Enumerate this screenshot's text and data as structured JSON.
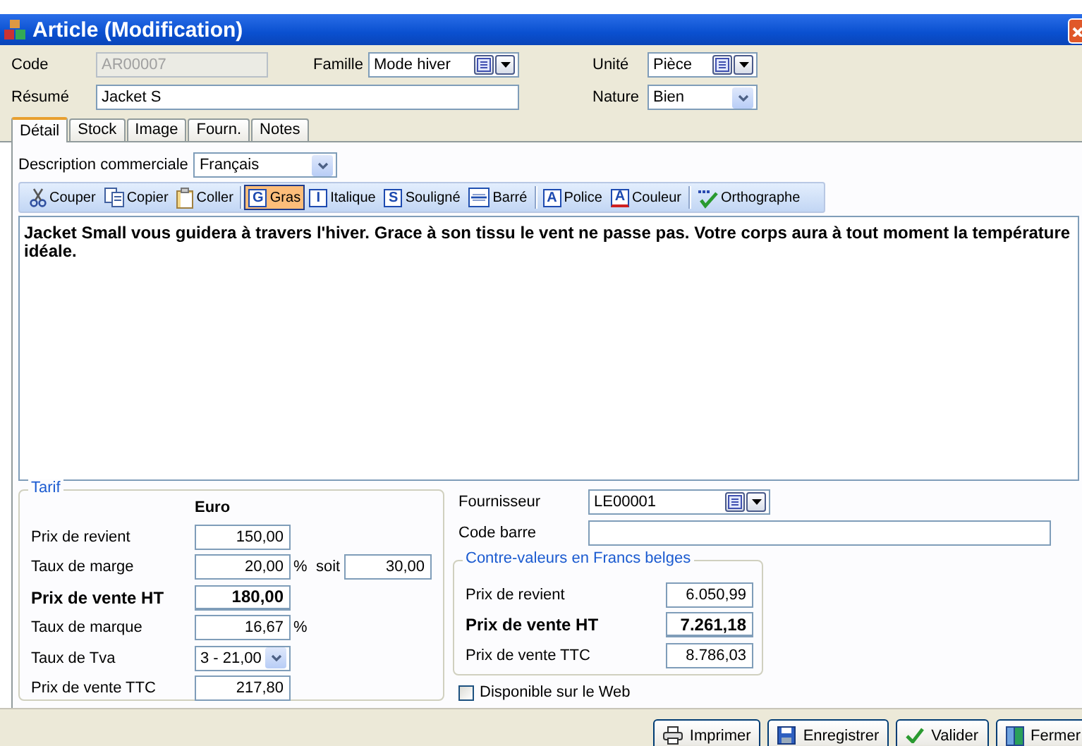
{
  "window": {
    "title": "Article (Modification)"
  },
  "header": {
    "code": {
      "label": "Code",
      "value": "AR00007",
      "disabled": true
    },
    "famille": {
      "label": "Famille",
      "value": "Mode hiver"
    },
    "unite": {
      "label": "Unité",
      "value": "Pièce"
    },
    "resume": {
      "label": "Résumé",
      "value": "Jacket S",
      "disabled": false
    },
    "nature": {
      "label": "Nature",
      "value": "Bien"
    }
  },
  "tabs": [
    {
      "label": "Détail",
      "selected": true
    },
    {
      "label": "Stock",
      "selected": false
    },
    {
      "label": "Image",
      "selected": false
    },
    {
      "label": "Fourn.",
      "selected": false
    },
    {
      "label": "Notes",
      "selected": false
    }
  ],
  "description": {
    "label": "Description commerciale",
    "value": "Français"
  },
  "toolbar": [
    {
      "kind": "cut",
      "label": "Couper",
      "selected": false,
      "separator_before": false
    },
    {
      "kind": "copy",
      "label": "Copier",
      "selected": false,
      "separator_before": false
    },
    {
      "kind": "paste",
      "label": "Coller",
      "selected": false,
      "separator_before": false
    },
    {
      "kind": "glyph",
      "glyph": "G",
      "label": "Gras",
      "selected": true,
      "separator_before": true
    },
    {
      "kind": "glyph",
      "glyph": "I",
      "label": "Italique",
      "selected": false,
      "separator_before": false
    },
    {
      "kind": "glyph",
      "glyph": "S",
      "label": "Souligné",
      "selected": false,
      "separator_before": false
    },
    {
      "kind": "strike",
      "label": "Barré",
      "selected": false,
      "separator_before": false
    },
    {
      "kind": "glyph",
      "glyph": "A",
      "label": "Police",
      "selected": false,
      "separator_before": true
    },
    {
      "kind": "color",
      "glyph": "A",
      "label": "Couleur",
      "selected": false,
      "separator_before": false
    },
    {
      "kind": "spell",
      "label": "Orthographe",
      "selected": false,
      "separator_before": true
    }
  ],
  "editor": {
    "text": "Jacket Small vous guidera à travers l'hiver. Grace à son tissu le vent ne passe pas. Votre corps aura à tout moment la température idéale."
  },
  "tarif": {
    "title": "Tarif",
    "currency": "Euro",
    "rows": [
      {
        "kind": "field",
        "label": "Prix de revient",
        "value": "150,00",
        "bold": false
      },
      {
        "kind": "percent_soit",
        "label": "Taux de marge",
        "value": "20,00",
        "suffix": "%",
        "extra_label": "soit",
        "extra_value": "30,00",
        "bold": false
      },
      {
        "kind": "field",
        "label": "Prix de vente HT",
        "value": "180,00",
        "bold": true
      },
      {
        "kind": "percent",
        "label": "Taux de marque",
        "value": "16,67",
        "suffix": "%",
        "bold": false
      },
      {
        "kind": "combo",
        "label": "Taux de Tva",
        "value": "3 - 21,00",
        "bold": false
      },
      {
        "kind": "field",
        "label": "Prix de vente TTC",
        "value": "217,80",
        "bold": false
      }
    ]
  },
  "fournisseur": {
    "label": "Fournisseur",
    "value": "LE00001"
  },
  "code_barre": {
    "label": "Code barre"
  },
  "contre_valeurs": {
    "title": "Contre-valeurs en Francs belges",
    "rows": [
      {
        "label": "Prix de revient",
        "value": "6.050,99",
        "bold": false
      },
      {
        "label": "Prix de vente HT",
        "value": "7.261,18",
        "bold": true
      },
      {
        "label": "Prix de vente TTC",
        "value": "8.786,03",
        "bold": false
      }
    ]
  },
  "web": {
    "label": "Disponible sur le Web",
    "checked": false
  },
  "buttons": [
    {
      "kind": "print",
      "label": "Imprimer"
    },
    {
      "kind": "save",
      "label": "Enregistrer"
    },
    {
      "kind": "check",
      "label": "Valider"
    },
    {
      "kind": "close",
      "label": "Fermer"
    }
  ]
}
